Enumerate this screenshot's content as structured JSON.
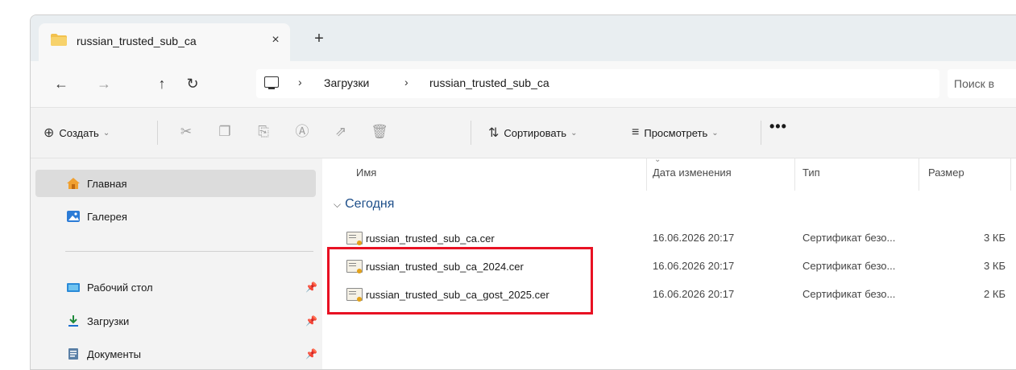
{
  "tab": {
    "title": "russian_trusted_sub_ca",
    "close": "×",
    "new": "+"
  },
  "nav": {
    "back": "←",
    "forward": "→",
    "up": "↑",
    "refresh": "↻"
  },
  "address": {
    "sep": "›",
    "crumbs": [
      "Загрузки",
      "russian_trusted_sub_ca"
    ]
  },
  "search": {
    "placeholder": "Поиск в"
  },
  "toolbar": {
    "create": "Создать",
    "sort": "Сортировать",
    "view": "Просмотреть",
    "more": "•••"
  },
  "sidebar": {
    "items": [
      {
        "label": "Главная"
      },
      {
        "label": "Галерея"
      },
      {
        "label": "Рабочий стол"
      },
      {
        "label": "Загрузки"
      },
      {
        "label": "Документы"
      }
    ]
  },
  "columns": {
    "name": "Имя",
    "date": "Дата изменения",
    "type": "Тип",
    "size": "Размер"
  },
  "group": {
    "label": "Сегодня"
  },
  "files": [
    {
      "name": "russian_trusted_sub_ca.cer",
      "date": "16.06.2026 20:17",
      "type": "Сертификат безо...",
      "size": "3 КБ"
    },
    {
      "name": "russian_trusted_sub_ca_2024.cer",
      "date": "16.06.2026 20:17",
      "type": "Сертификат безо...",
      "size": "3 КБ"
    },
    {
      "name": "russian_trusted_sub_ca_gost_2025.cer",
      "date": "16.06.2026 20:17",
      "type": "Сертификат безо...",
      "size": "2 КБ"
    }
  ],
  "colors": {
    "highlight": "#e81123",
    "group": "#1d4e89",
    "folder": "#f2c14e"
  }
}
